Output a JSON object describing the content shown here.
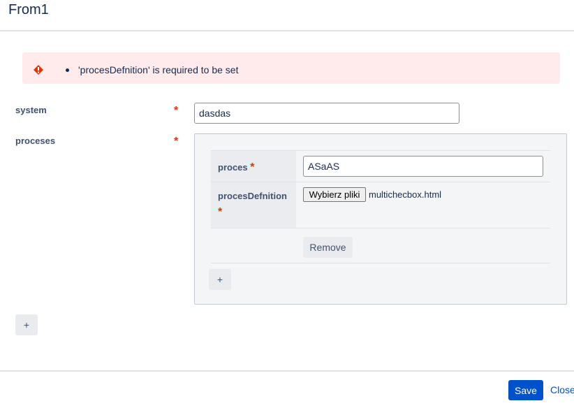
{
  "dialog": {
    "title": "From1"
  },
  "error": {
    "icon": "error-icon",
    "messages": [
      "'procesDefnition' is required to be set"
    ],
    "color": "#ffebeb"
  },
  "form": {
    "system": {
      "label": "system",
      "required": "*",
      "value": "dasdas"
    },
    "proceses": {
      "label": "proceses",
      "required": "*",
      "proces": {
        "label": "proces",
        "required": "*",
        "value": "ASaAS"
      },
      "procesDefnition": {
        "label": "procesDefnition",
        "required": "*",
        "file_button": "Wybierz pliki",
        "file_name": "multichecbox.html"
      },
      "remove_label": "Remove",
      "add_item_label": "+"
    },
    "add_label": "+"
  },
  "footer": {
    "save_label": "Save",
    "close_label": "Close"
  },
  "colors": {
    "accent": "#0052cc",
    "required": "#de350b",
    "error_bg": "#ffebeb"
  }
}
